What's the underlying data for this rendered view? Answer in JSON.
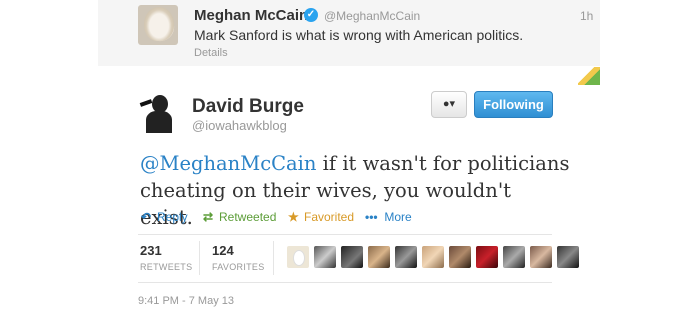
{
  "top_tweet": {
    "name": "Meghan McCain",
    "handle": "@MeghanMcCain",
    "time": "1h",
    "text": "Mark Sanford is what is wrong with American politics.",
    "details_link": "Details"
  },
  "main_tweet": {
    "name": "David Burge",
    "handle": "@iowahawkblog",
    "following_label": "Following",
    "mention": "@MeghanMcCain",
    "text_line1": " if it wasn't for politicians",
    "text_line2": "cheating on their wives, you wouldn't exist.",
    "actions": {
      "reply": "Reply",
      "retweeted": "Retweeted",
      "favorited": "Favorited",
      "more": "More"
    },
    "stats": {
      "retweets_count": "231",
      "retweets_label": "RETWEETS",
      "favorites_count": "124",
      "favorites_label": "FAVORITES"
    },
    "timestamp": "9:41 PM - 7 May 13"
  },
  "icons": {
    "verified": "verified-badge-icon",
    "reply": "reply-arrow-icon",
    "retweet": "retweet-icon",
    "favorite": "star-icon",
    "more": "dots-icon",
    "user": "user-icon"
  },
  "colors": {
    "link": "#2a82c6",
    "retweet": "#5c9d38",
    "favorite": "#d89a28",
    "follow_button": "#3d9be0",
    "verified": "#2aa3ef"
  }
}
